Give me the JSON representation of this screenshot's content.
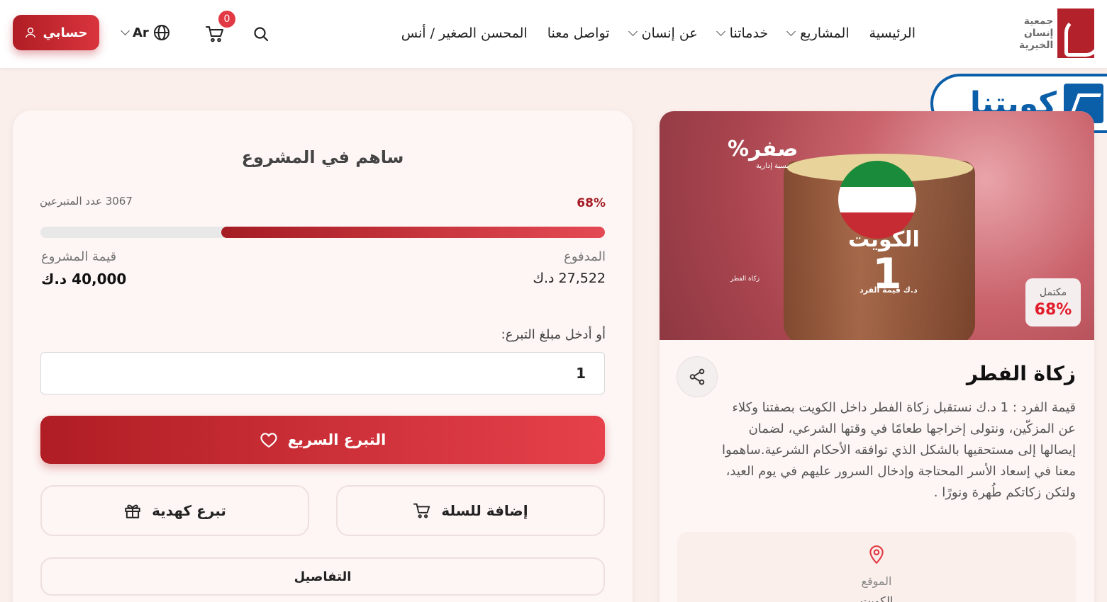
{
  "header": {
    "logo_lines": [
      "جمعية",
      "إنسان",
      "الخيرية"
    ],
    "nav": [
      {
        "label": "الرئيسية",
        "has_dropdown": false
      },
      {
        "label": "المشاريع",
        "has_dropdown": true
      },
      {
        "label": "خدماتنا",
        "has_dropdown": true
      },
      {
        "label": "عن إنسان",
        "has_dropdown": true
      },
      {
        "label": "تواصل معنا",
        "has_dropdown": false
      },
      {
        "label": "المحسن الصغير / أنس",
        "has_dropdown": false
      }
    ],
    "cart_count": "0",
    "lang": "Ar",
    "account_label": "حسابي"
  },
  "watermark": {
    "text": "كويتنا"
  },
  "donate": {
    "title": "ساهم في المشروع",
    "percent_label": "68%",
    "progress_fraction": 0.68,
    "donors": "3067 عدد المتبرعين",
    "paid_label": "المدفوع",
    "paid_value": "27,522 د.ك",
    "goal_label": "قيمة المشروع",
    "goal_value": "40,000 د.ك",
    "amount_label": "أو أدخل مبلغ التبرع:",
    "amount_value": "1",
    "quick_donate": "التبرع السريع",
    "add_to_cart": "إضافة للسلة",
    "gift_donate": "تبرع كهدية",
    "details": "التفاصيل"
  },
  "project": {
    "image": {
      "zero_text": "صفر%",
      "zero_sub": "نسبة إدارية",
      "kuwait": "الكويت",
      "value": "1",
      "unit": "د.ك",
      "unit_sub": "قيمة الفرد",
      "zakat_small": "زكاة الفطر"
    },
    "done_label": "مكتمل",
    "done_pct": "68%",
    "title": "زكاة الفطر",
    "description": "قيمة الفرد : 1 د.ك نستقبل زكاة الفطر داخل الكويت بصفتنا وكلاء عن المزكّين، ونتولى إخراجها طعامًا في وقتها الشرعي، لضمان إيصالها إلى مستحقيها بالشكل الذي توافقه الأحكام الشرعية.ساهموا معنا في إسعاد الأسر المحتاجة وإدخال السرور عليهم في يوم العيد، ولتكن زكاتكم طُهرة ونورًا .",
    "location_label": "الموقع",
    "location_value": "الكويت"
  },
  "colors": {
    "brand_red": "#b01d24",
    "accent_red": "#e23a44",
    "bg": "#fbefec",
    "kw_blue": "#0b5ea8"
  }
}
